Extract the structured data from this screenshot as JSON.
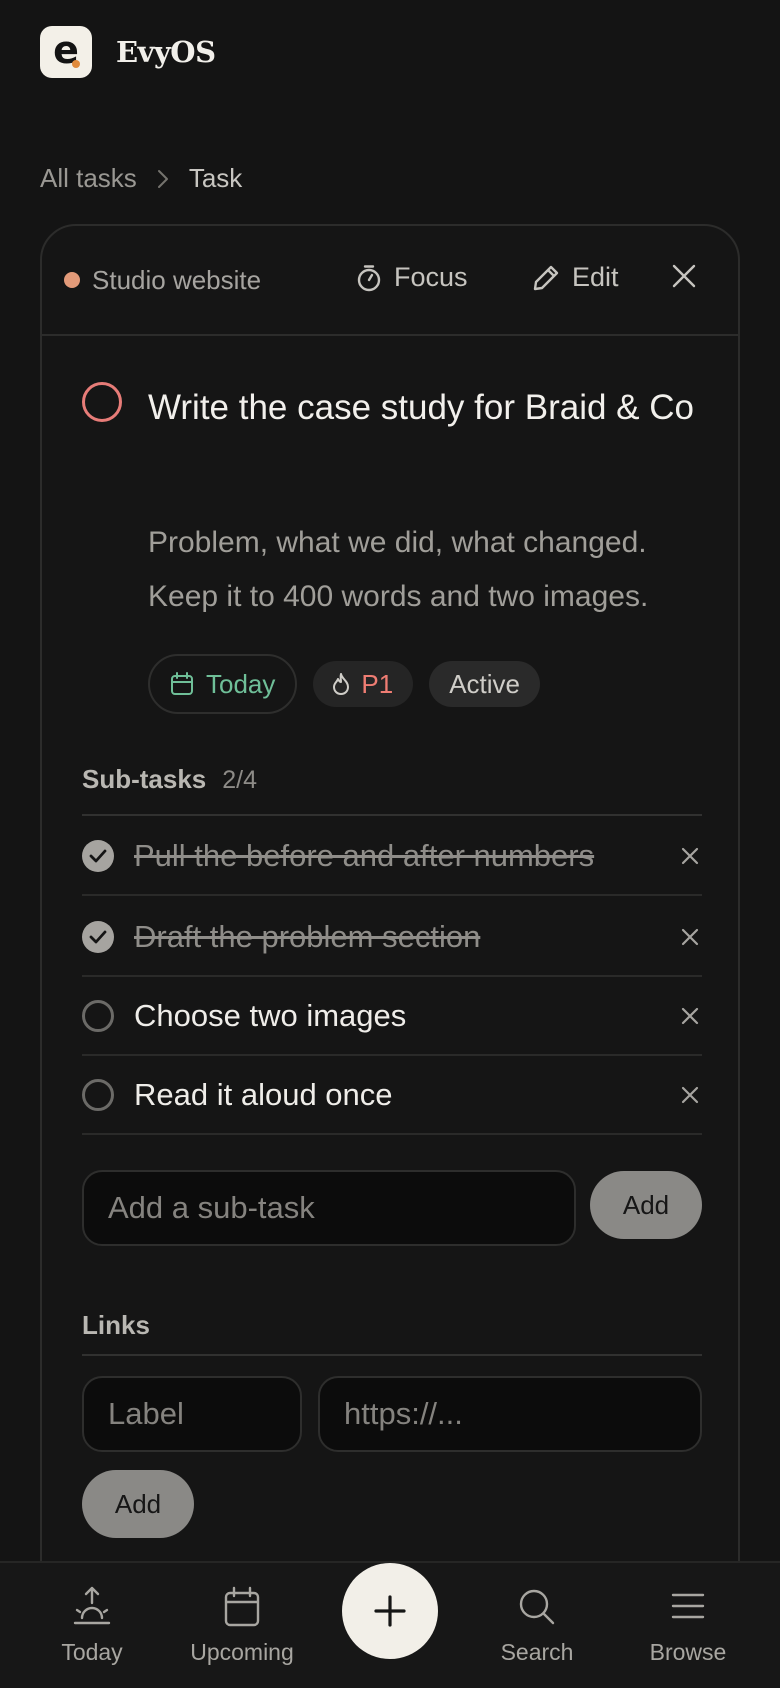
{
  "app": {
    "name": "EvyOS",
    "logo_letter": "e"
  },
  "breadcrumb": {
    "parent": "All tasks",
    "current": "Task"
  },
  "card": {
    "project": {
      "name": "Studio website",
      "color": "#e29a79"
    },
    "actions": {
      "focus": "Focus",
      "edit": "Edit"
    },
    "task": {
      "title": "Write the case study for Braid & Co",
      "description": "Problem, what we did, what changed. Keep it to 400 words and two images.",
      "date": "Today",
      "priority": "P1",
      "status": "Active"
    },
    "subtasks": {
      "title": "Sub-tasks",
      "count": "2/4",
      "items": [
        {
          "label": "Pull the before and after numbers",
          "done": true
        },
        {
          "label": "Draft the problem section",
          "done": true
        },
        {
          "label": "Choose two images",
          "done": false
        },
        {
          "label": "Read it aloud once",
          "done": false
        }
      ],
      "input_placeholder": "Add a sub-task",
      "add_label": "Add"
    },
    "links": {
      "title": "Links",
      "label_placeholder": "Label",
      "url_placeholder": "https://...",
      "add_label": "Add"
    }
  },
  "nav": {
    "items": [
      {
        "label": "Today",
        "icon": "sunrise-icon"
      },
      {
        "label": "Upcoming",
        "icon": "calendar-icon"
      },
      {
        "label": "Search",
        "icon": "search-icon"
      },
      {
        "label": "Browse",
        "icon": "menu-icon"
      }
    ],
    "fab_icon": "plus-icon"
  },
  "colors": {
    "background": "#141414",
    "accent_red": "#e77c78",
    "accent_green": "#6fbf98",
    "priority": "#ef7d73"
  }
}
